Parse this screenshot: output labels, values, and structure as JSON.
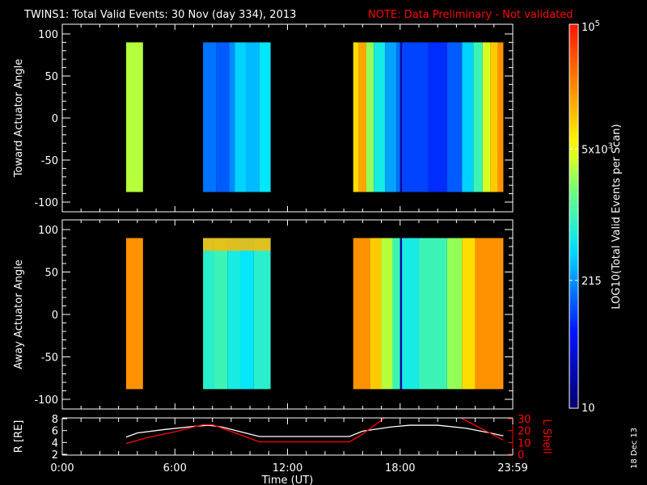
{
  "title": "TWINS1: Total Valid Events: 30 Nov (day 334), 2013",
  "note": "NOTE: Data Preliminary - Not validated",
  "date_stamp": "18 Dec 13",
  "colors": {
    "background": "#000000",
    "axes": "#ffffff",
    "note": "#ff0000",
    "lshell": "#ff0000",
    "radius": "#ffffff"
  },
  "chart_data": {
    "type": "heatmap",
    "x_label": "Time (UT)",
    "x_range_hours": [
      0,
      24
    ],
    "x_ticks": [
      {
        "h": 0,
        "label": "0:00"
      },
      {
        "h": 6,
        "label": "6:00"
      },
      {
        "h": 12,
        "label": "12:00"
      },
      {
        "h": 18,
        "label": "18:00"
      },
      {
        "h": 24,
        "label": "23:59"
      }
    ],
    "y_range": [
      -110,
      110
    ],
    "y_ticks": [
      100,
      50,
      0,
      -50,
      -100
    ],
    "data_angle_range": [
      -88,
      90
    ],
    "colorbar": {
      "label": "LOG10(Total Valid Events per Scan)",
      "log_range": [
        1,
        5
      ],
      "ticks": [
        {
          "log": 5,
          "label": "10",
          "sup": "5"
        },
        {
          "log": 3.699,
          "label": "5x10",
          "sup": "3"
        },
        {
          "log": 2.332,
          "label": "215",
          "sup": ""
        },
        {
          "log": 1,
          "label": "10",
          "sup": ""
        }
      ]
    },
    "panels": [
      {
        "ylabel": "Toward Actuator Angle",
        "columns": [
          [
            3.4,
            4.3,
            3.5
          ],
          [
            7.5,
            8.2,
            2.2
          ],
          [
            8.2,
            8.9,
            2.1
          ],
          [
            8.9,
            9.2,
            2.3
          ],
          [
            9.2,
            9.8,
            2.6
          ],
          [
            9.8,
            10.5,
            2.5
          ],
          [
            10.5,
            11.1,
            2.7
          ],
          [
            15.5,
            15.8,
            3.9
          ],
          [
            15.8,
            16.2,
            4.2
          ],
          [
            16.2,
            16.6,
            3.4
          ],
          [
            16.6,
            17.2,
            2.8
          ],
          [
            17.2,
            17.8,
            2.4
          ],
          [
            17.8,
            18.0,
            2.2
          ],
          [
            18.0,
            18.1,
            1.3
          ],
          [
            18.1,
            19.5,
            2.0
          ],
          [
            19.5,
            20.5,
            1.9
          ],
          [
            20.5,
            21.3,
            2.1
          ],
          [
            21.3,
            21.9,
            2.6
          ],
          [
            21.9,
            22.4,
            3.0
          ],
          [
            22.4,
            22.8,
            3.6
          ],
          [
            22.8,
            23.2,
            4.0
          ],
          [
            23.2,
            23.5,
            4.3
          ]
        ],
        "bands": []
      },
      {
        "ylabel": "Away Actuator Angle",
        "columns": [
          [
            3.4,
            4.3,
            4.3
          ],
          [
            7.5,
            8.1,
            2.9
          ],
          [
            8.1,
            8.8,
            3.0
          ],
          [
            8.8,
            9.5,
            2.8
          ],
          [
            9.5,
            10.2,
            2.7
          ],
          [
            10.2,
            11.1,
            2.9
          ],
          [
            15.5,
            16.4,
            4.3
          ],
          [
            16.4,
            17.0,
            4.0
          ],
          [
            17.0,
            17.6,
            3.5
          ],
          [
            17.6,
            18.0,
            3.0
          ],
          [
            18.0,
            18.1,
            1.3
          ],
          [
            18.1,
            19.0,
            2.8
          ],
          [
            19.0,
            20.5,
            3.0
          ],
          [
            20.5,
            21.3,
            3.4
          ],
          [
            21.3,
            22.0,
            3.9
          ],
          [
            22.0,
            23.5,
            4.3
          ]
        ],
        "bands": [
          [
            7.5,
            11.1,
            75,
            90,
            4.1
          ]
        ]
      }
    ],
    "orbit": {
      "left_label": "R [RE]",
      "right_label": "L Shell",
      "left_range": [
        2,
        8
      ],
      "left_ticks": [
        2,
        4,
        6,
        8
      ],
      "right_range": [
        0,
        30
      ],
      "right_ticks": [
        0,
        10,
        20,
        30
      ],
      "radius": [
        [
          3.4,
          4.9
        ],
        [
          4,
          5.6
        ],
        [
          5.5,
          6.2
        ],
        [
          7,
          6.7
        ],
        [
          7.8,
          6.9
        ],
        [
          8.5,
          6.6
        ],
        [
          9.5,
          5.8
        ],
        [
          10.5,
          5.0
        ],
        [
          15.3,
          5.0
        ],
        [
          16,
          5.9
        ],
        [
          17.5,
          6.6
        ],
        [
          18.5,
          6.9
        ],
        [
          20,
          6.9
        ],
        [
          21.5,
          6.4
        ],
        [
          22.8,
          5.6
        ],
        [
          23.5,
          5.1
        ]
      ],
      "lshell": [
        [
          3.4,
          9
        ],
        [
          4.5,
          14
        ],
        [
          6,
          19
        ],
        [
          7.5,
          25
        ],
        [
          8,
          25
        ],
        [
          10.5,
          10.5
        ],
        [
          15.3,
          10.5
        ],
        [
          16,
          17
        ],
        [
          17.2,
          31
        ]
      ],
      "lshell_2": [
        [
          21.2,
          31
        ],
        [
          23.5,
          12
        ]
      ]
    }
  }
}
